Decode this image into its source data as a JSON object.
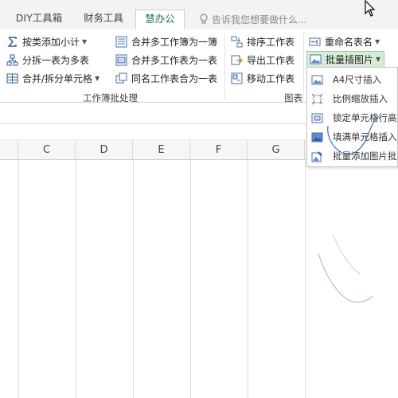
{
  "tabs": [
    {
      "label": "DIY工具箱",
      "active": false
    },
    {
      "label": "财务工具",
      "active": false
    },
    {
      "label": "慧办公",
      "active": true
    }
  ],
  "tell_me": {
    "text": "告诉我您想要做什么..."
  },
  "ribbon": {
    "group1": {
      "label": "工作簿批处理",
      "buttons": [
        "按类添加小计",
        "分拆一表为多表",
        "合并/拆分单元格"
      ]
    },
    "group2": {
      "buttons": [
        "合并多工作簿为一簿",
        "合并多工作表为一表",
        "同名工作表合为一表"
      ]
    },
    "group3": {
      "label": "图表",
      "buttons": [
        "排序工作表",
        "导出工作表",
        "移动工作表"
      ]
    },
    "group4": {
      "buttons": [
        "重命名表名",
        "批量插图片"
      ]
    }
  },
  "dropdown": {
    "items": [
      "A4尺寸插入",
      "比例缩放插入",
      "锁定单元格行高",
      "填满单元格插入",
      "批量添加图片批"
    ]
  },
  "sheet": {
    "columns": [
      "C",
      "D",
      "E",
      "F",
      "G"
    ]
  },
  "colors": {
    "accent": "#217346",
    "highlight_bg": "#d9ecd9",
    "gridline": "#dcdcdc"
  }
}
